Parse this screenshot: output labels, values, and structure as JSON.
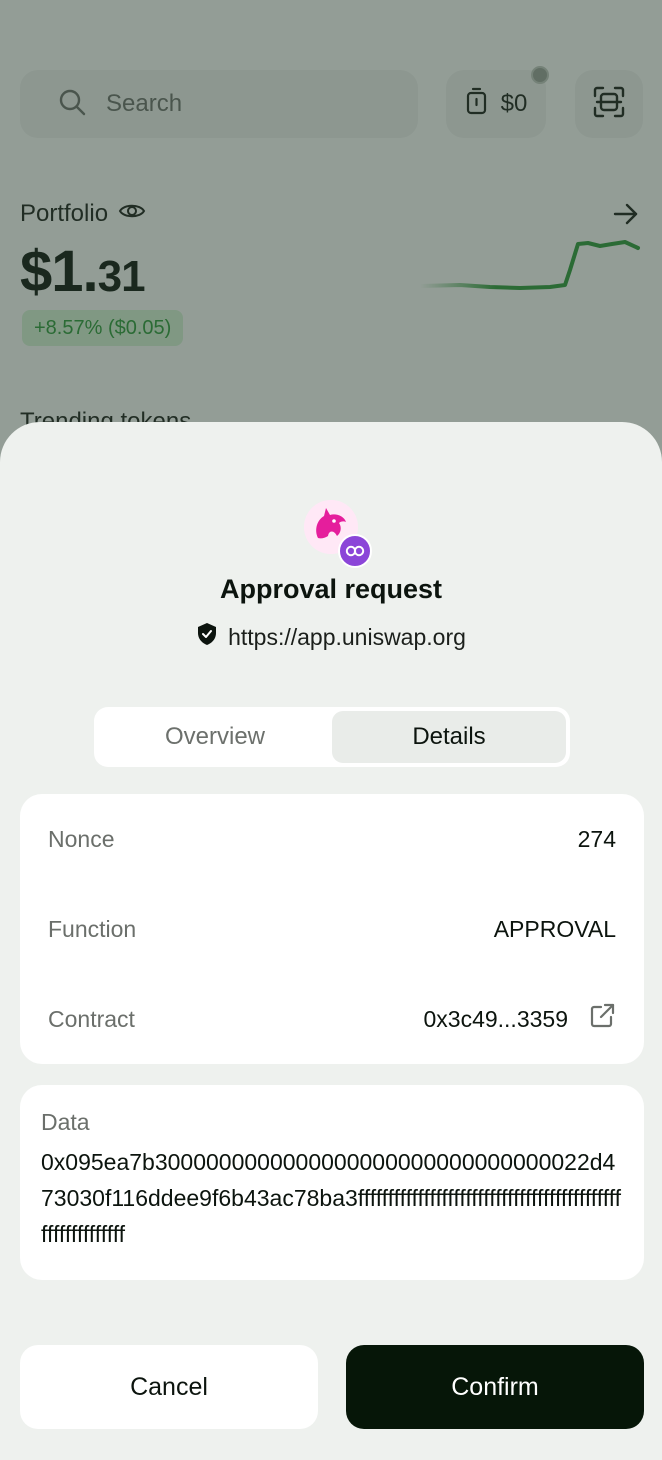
{
  "background": {
    "search": {
      "placeholder": "Search"
    },
    "balance": {
      "label": "$0"
    },
    "portfolio": {
      "label": "Portfolio",
      "value_main": "$1.",
      "value_cents": "31",
      "change": "+8.57% ($0.05)"
    },
    "trending_label": "Trending tokens"
  },
  "sheet": {
    "title": "Approval request",
    "site_url": "https://app.uniswap.org",
    "tabs": [
      {
        "label": "Overview",
        "active": false
      },
      {
        "label": "Details",
        "active": true
      }
    ],
    "details": [
      {
        "key": "Nonce",
        "value": "274"
      },
      {
        "key": "Function",
        "value": "APPROVAL"
      },
      {
        "key": "Contract",
        "value": "0x3c49...3359",
        "icon": "external-link-icon"
      }
    ],
    "data": {
      "key": "Data",
      "value": "0x095ea7b3000000000000000000000000000000022d473030f116ddee9f6b43ac78ba3ffffffffffffffffffffffffffffffffffffffffffffffffffffffffff"
    },
    "buttons": {
      "cancel": "Cancel",
      "confirm": "Confirm"
    }
  },
  "colors": {
    "confirm_bg": "#061608",
    "positive": "#2f9a3c",
    "chain_badge": "#8b45d8",
    "sheet_bg": "#eef1ee"
  }
}
